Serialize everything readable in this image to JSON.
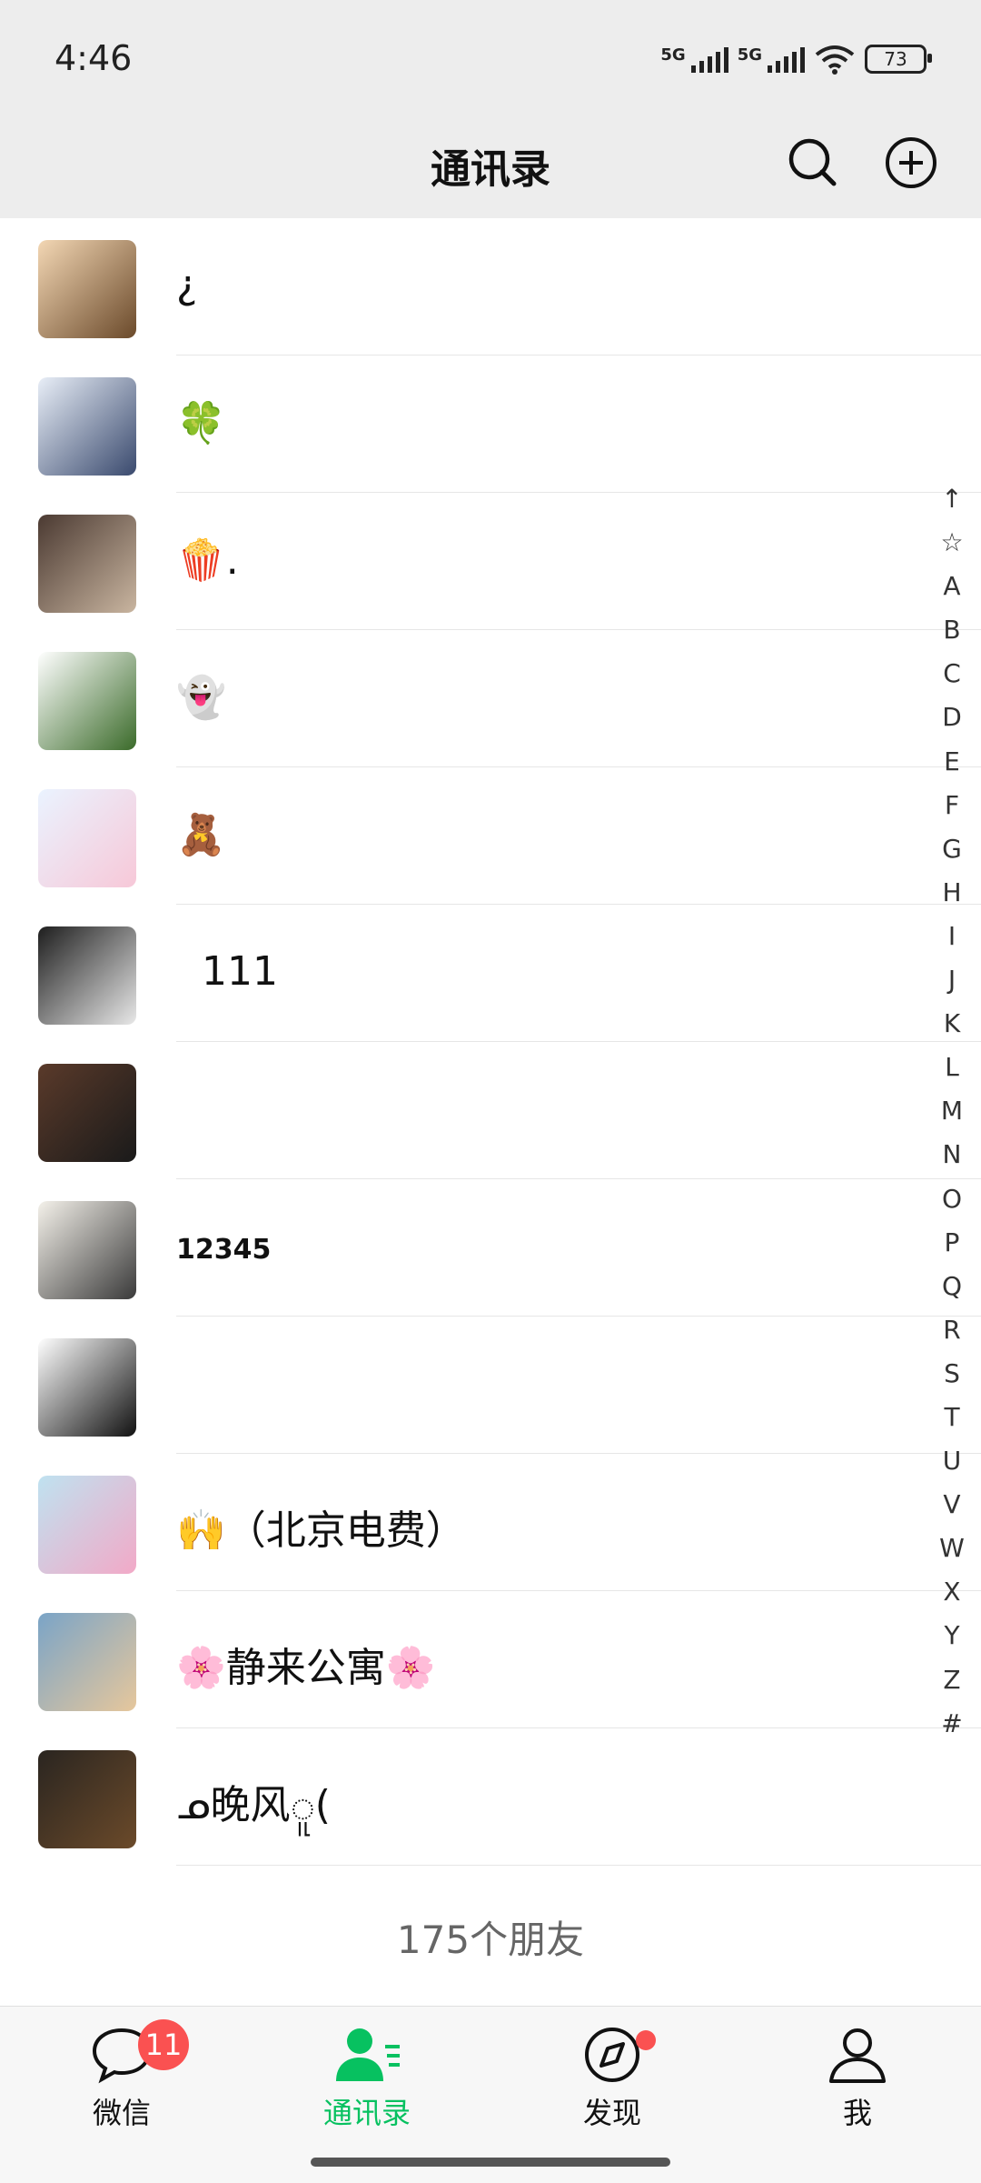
{
  "status": {
    "time": "4:46",
    "net1": "5G",
    "net2": "5G",
    "battery": "73"
  },
  "header": {
    "title": "通讯录"
  },
  "contacts": [
    {
      "name": "¿",
      "avatar_colors": [
        "#f3d7b4",
        "#6b4a2b"
      ]
    },
    {
      "name": "🍀",
      "avatar_colors": [
        "#e8eef7",
        "#3a4a6e"
      ]
    },
    {
      "name": "🍿.",
      "avatar_colors": [
        "#4b3a32",
        "#c9b5a0"
      ]
    },
    {
      "name": "👻",
      "avatar_colors": [
        "#ffffff",
        "#3b6b2a"
      ]
    },
    {
      "name": "🧸",
      "avatar_colors": [
        "#eaf3ff",
        "#f7c8d8"
      ]
    },
    {
      "name": "  111",
      "avatar_colors": [
        "#1e1e1e",
        "#e8e8e8"
      ]
    },
    {
      "name": "",
      "avatar_colors": [
        "#5a3a2a",
        "#1a1a1a"
      ]
    },
    {
      "name": "12345",
      "avatar_colors": [
        "#f4f1ea",
        "#3a3a3a"
      ]
    },
    {
      "name": "",
      "avatar_colors": [
        "#ffffff",
        "#111111"
      ]
    },
    {
      "name": "🙌（北京电费）",
      "avatar_colors": [
        "#bfe2f0",
        "#f2a9c7"
      ]
    },
    {
      "name": "🌸静来公寓🌸",
      "avatar_colors": [
        "#7aa4c7",
        "#e6c79c"
      ]
    },
    {
      "name": "ᓄ晚风ူ(",
      "avatar_colors": [
        "#2a2520",
        "#6b4a2a"
      ]
    }
  ],
  "index_letters": [
    "↑",
    "☆",
    "A",
    "B",
    "C",
    "D",
    "E",
    "F",
    "G",
    "H",
    "I",
    "J",
    "K",
    "L",
    "M",
    "N",
    "O",
    "P",
    "Q",
    "R",
    "S",
    "T",
    "U",
    "V",
    "W",
    "X",
    "Y",
    "Z",
    "#"
  ],
  "friend_count": "175个朋友",
  "tabs": [
    {
      "label": "微信",
      "icon": "chat-icon",
      "badge": "11"
    },
    {
      "label": "通讯录",
      "icon": "contacts-icon",
      "active": true
    },
    {
      "label": "发现",
      "icon": "discover-icon",
      "dot": true
    },
    {
      "label": "我",
      "icon": "me-icon"
    }
  ],
  "colors": {
    "accent": "#07c160",
    "badge": "#fa5151"
  }
}
